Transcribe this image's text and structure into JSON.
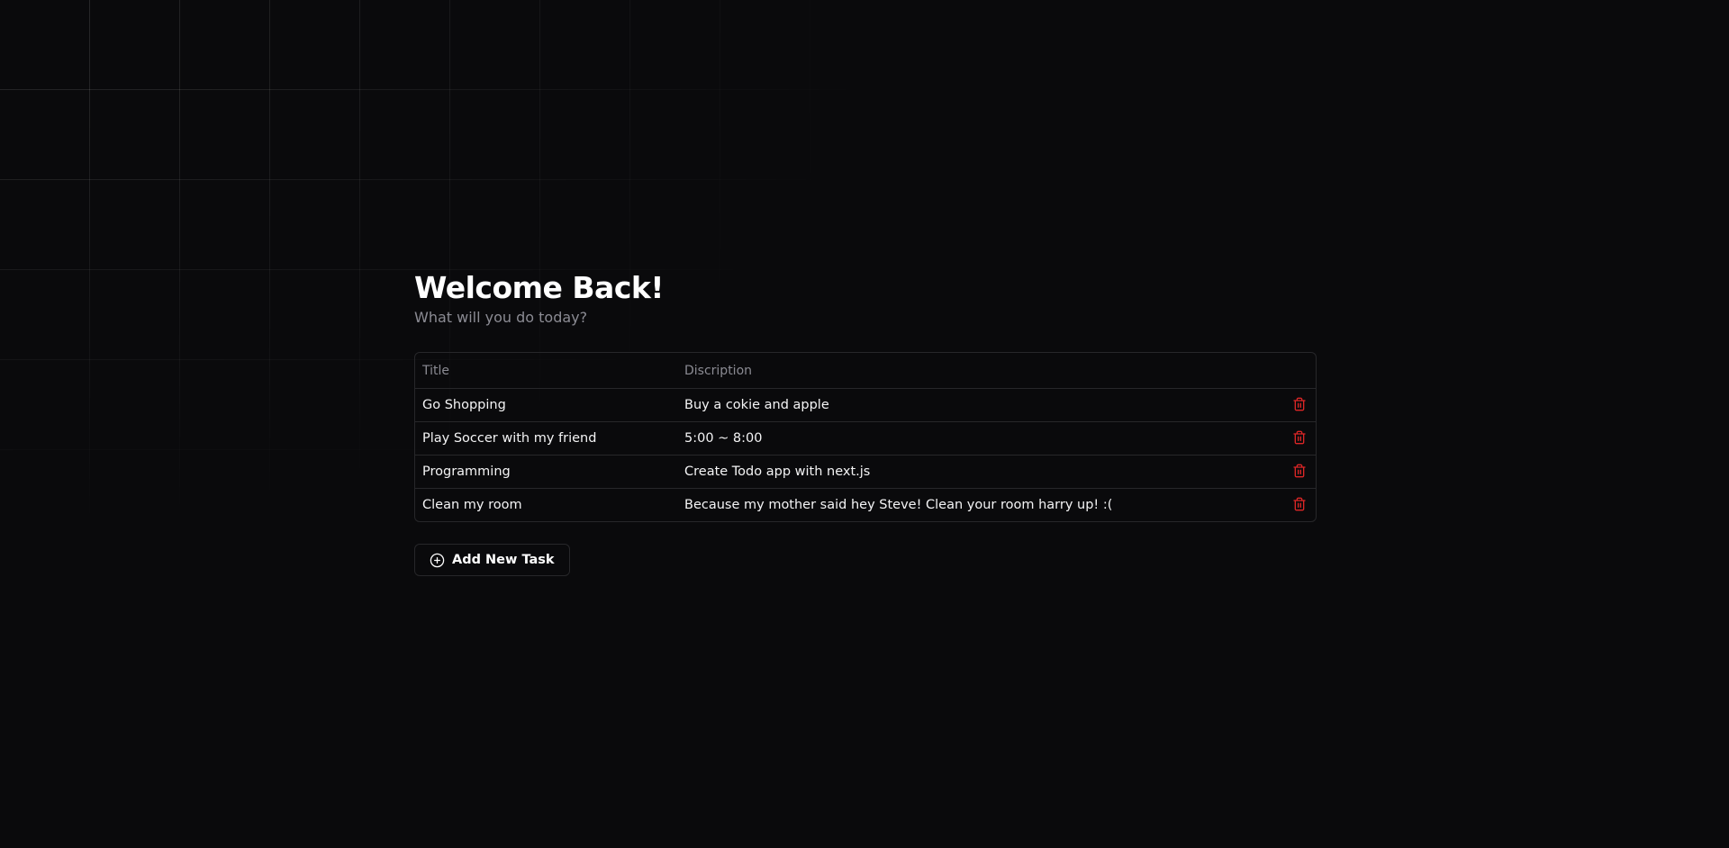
{
  "header": {
    "title": "Welcome Back!",
    "subtitle": "What will you do today?"
  },
  "table": {
    "columns": {
      "title": "Title",
      "description": "Discription"
    },
    "rows": [
      {
        "title": "Go Shopping",
        "description": "Buy a cokie and apple"
      },
      {
        "title": "Play Soccer with my friend",
        "description": "5:00 ~ 8:00"
      },
      {
        "title": "Programming",
        "description": "Create Todo app with next.js"
      },
      {
        "title": "Clean my room",
        "description": "Because my mother said hey Steve! Clean your room harry up! :("
      }
    ]
  },
  "add_button": {
    "label": "Add New Task",
    "icon": "plus-circle-icon"
  },
  "icons": {
    "row_action": "trash-icon"
  },
  "colors": {
    "background": "#0a0a0c",
    "border": "#27272a",
    "muted_text": "#8b8b93",
    "danger": "#dc2626"
  }
}
